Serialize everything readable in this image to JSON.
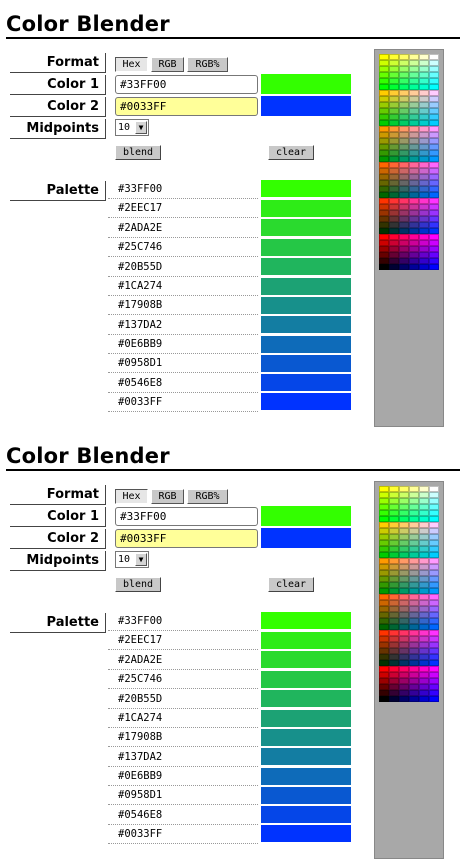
{
  "title": "Color Blender",
  "labels": {
    "format": "Format",
    "color1": "Color 1",
    "color2": "Color 2",
    "midpoints": "Midpoints",
    "palette": "Palette"
  },
  "format_buttons": [
    "Hex",
    "RGB",
    "RGB%"
  ],
  "active_format": "Hex",
  "color1": {
    "value": "#33FF00",
    "swatch": "#33FF00"
  },
  "color2": {
    "value": "#0033FF",
    "swatch": "#0033FF"
  },
  "midpoints": {
    "value": "10"
  },
  "buttons": {
    "blend": "blend",
    "clear": "clear"
  },
  "palette": [
    "#33FF00",
    "#2EEC17",
    "#2ADA2E",
    "#25C746",
    "#20B55D",
    "#1CA274",
    "#17908B",
    "#137DA2",
    "#0E6BB9",
    "#0958D1",
    "#0546E8",
    "#0033FF"
  ],
  "icons": {
    "select_arrow": "down-arrow-icon"
  }
}
